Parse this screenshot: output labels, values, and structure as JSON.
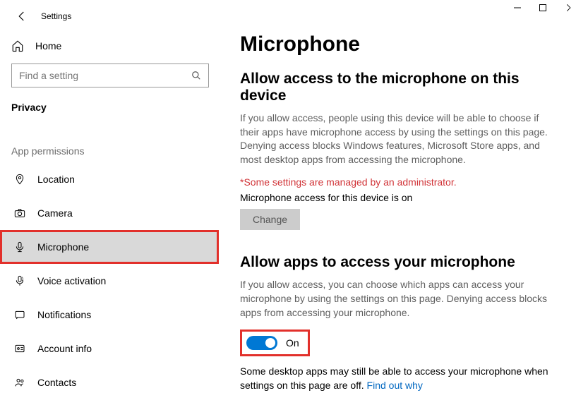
{
  "window": {
    "title": "Settings"
  },
  "sidebar": {
    "home": "Home",
    "search_placeholder": "Find a setting",
    "category": "Privacy",
    "section_label": "App permissions",
    "items": [
      {
        "label": "Location"
      },
      {
        "label": "Camera"
      },
      {
        "label": "Microphone"
      },
      {
        "label": "Voice activation"
      },
      {
        "label": "Notifications"
      },
      {
        "label": "Account info"
      },
      {
        "label": "Contacts"
      }
    ]
  },
  "main": {
    "page_title": "Microphone",
    "section1": {
      "title": "Allow access to the microphone on this device",
      "desc": "If you allow access, people using this device will be able to choose if their apps have microphone access by using the settings on this page. Denying access blocks Windows features, Microsoft Store apps, and most desktop apps from accessing the microphone.",
      "admin_note": "*Some settings are managed by an administrator.",
      "status": "Microphone access for this device is on",
      "change_btn": "Change"
    },
    "section2": {
      "title": "Allow apps to access your microphone",
      "desc": "If you allow access, you can choose which apps can access your microphone by using the settings on this page. Denying access blocks apps from accessing your microphone.",
      "toggle_state": "On",
      "footer": "Some desktop apps may still be able to access your microphone when settings on this page are off. ",
      "footer_link": "Find out why"
    }
  }
}
